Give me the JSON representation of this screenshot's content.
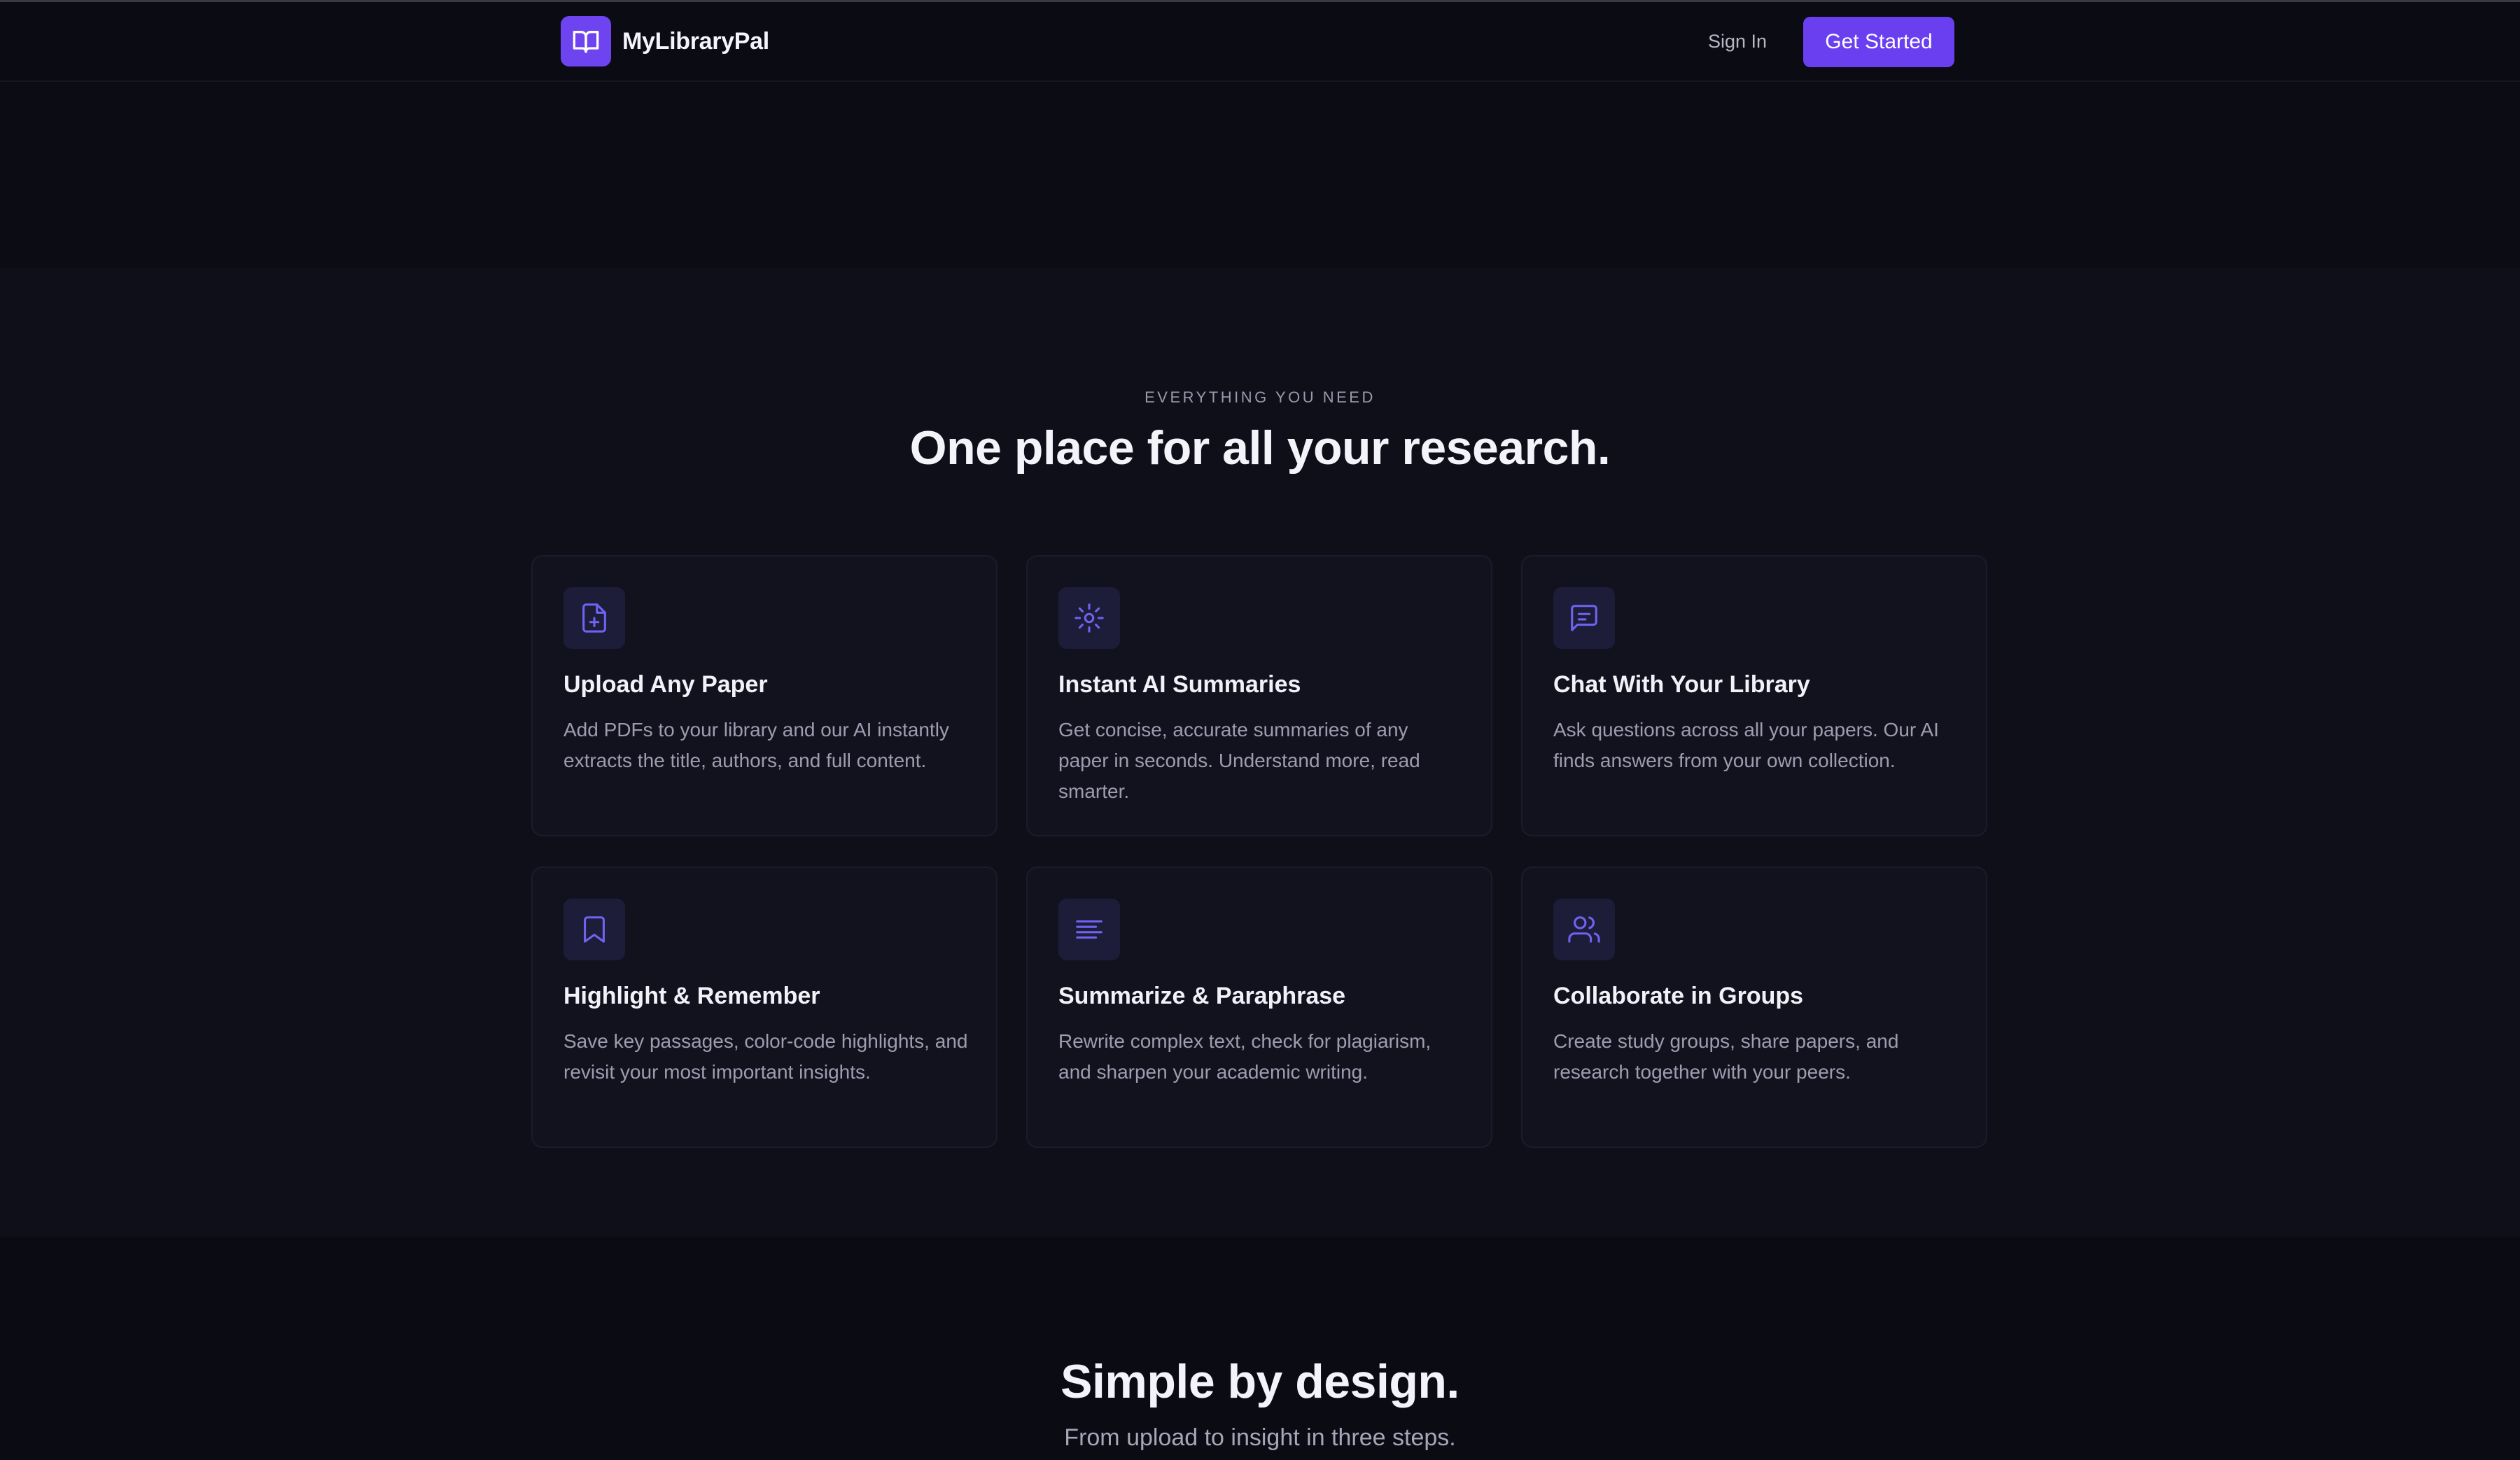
{
  "nav": {
    "brand_name": "MyLibraryPal",
    "logo_icon": "book-open-icon",
    "sign_in_label": "Sign In",
    "get_started_label": "Get Started"
  },
  "features": {
    "eyebrow": "EVERYTHING YOU NEED",
    "title": "One place for all your research.",
    "cards": [
      {
        "icon": "file-plus-icon",
        "title": "Upload Any Paper",
        "description": "Add PDFs to your library and our AI instantly extracts the title, authors, and full content."
      },
      {
        "icon": "sun-sparkle-icon",
        "title": "Instant AI Summaries",
        "description": "Get concise, accurate summaries of any paper in seconds. Understand more, read smarter."
      },
      {
        "icon": "message-square-icon",
        "title": "Chat With Your Library",
        "description": "Ask questions across all your papers. Our AI finds answers from your own collection."
      },
      {
        "icon": "bookmark-icon",
        "title": "Highlight & Remember",
        "description": "Save key passages, color-code highlights, and revisit your most important insights."
      },
      {
        "icon": "align-left-icon",
        "title": "Summarize & Paraphrase",
        "description": "Rewrite complex text, check for plagiarism, and sharpen your academic writing."
      },
      {
        "icon": "users-icon",
        "title": "Collaborate in Groups",
        "description": "Create study groups, share papers, and research together with your peers."
      }
    ]
  },
  "steps": {
    "title": "Simple by design.",
    "subtitle": "From upload to insight in three steps."
  },
  "colors": {
    "background": "#0b0b13",
    "section_background": "#0f0f19",
    "card_background": "#12121f",
    "accent": "#6a3ff0",
    "icon_tint": "#6f63f2",
    "icon_tile": "#1d1d3a"
  }
}
